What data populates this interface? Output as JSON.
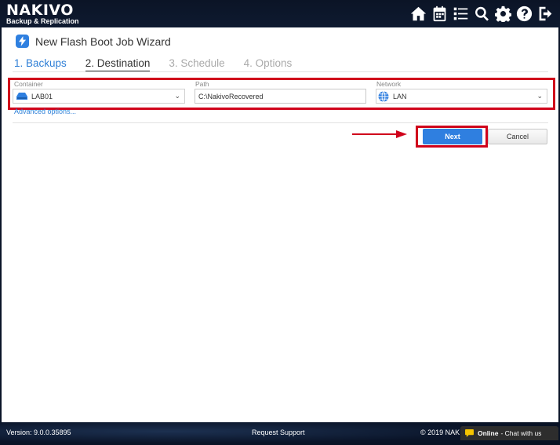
{
  "app": {
    "logo_main": "NAKIVO",
    "logo_sub": "Backup & Replication"
  },
  "top_icons": [
    "home-icon",
    "calendar-icon",
    "list-icon",
    "search-icon",
    "gear-icon",
    "help-icon",
    "logout-icon"
  ],
  "wizard": {
    "title": "New Flash Boot Job Wizard",
    "steps": [
      {
        "label": "1. Backups",
        "state": "done"
      },
      {
        "label": "2. Destination",
        "state": "active"
      },
      {
        "label": "3. Schedule",
        "state": "future"
      },
      {
        "label": "4. Options",
        "state": "future"
      }
    ],
    "container_label": "Container",
    "container_value": "LAB01",
    "path_label": "Path",
    "path_value": "C:\\NakivoRecovered",
    "network_label": "Network",
    "network_value": "LAN",
    "advanced_link": "Advanced options...",
    "next_label": "Next",
    "cancel_label": "Cancel"
  },
  "footer": {
    "version": "Version: 9.0.0.35895",
    "support": "Request Support",
    "copyright": "© 2019 NAK",
    "chat_status": "Online",
    "chat_text": "- Chat with us"
  },
  "colors": {
    "accent": "#2f7fe0",
    "highlight": "#d0021b",
    "background_dark": "#0a1428"
  }
}
